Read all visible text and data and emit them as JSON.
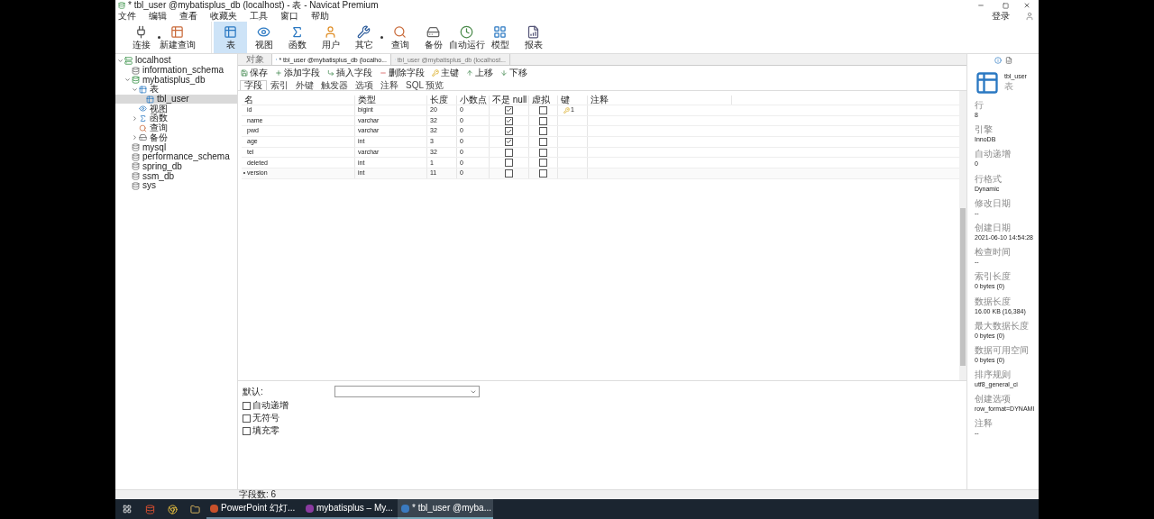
{
  "window": {
    "title": "* tbl_user @mybatisplus_db (localhost) - 表 - Navicat Premium"
  },
  "menu": [
    "文件",
    "编辑",
    "查看",
    "收藏夹",
    "工具",
    "窗口",
    "帮助"
  ],
  "login": "登录",
  "toolbar": [
    {
      "kind": "connect",
      "label": "连接",
      "selected": false,
      "dropdown": true
    },
    {
      "kind": "newquery",
      "label": "新建查询",
      "selected": false,
      "dropdown": false
    },
    {
      "kind": "table",
      "label": "表",
      "selected": true,
      "dropdown": false
    },
    {
      "kind": "view",
      "label": "视图",
      "selected": false,
      "dropdown": false
    },
    {
      "kind": "function",
      "label": "函数",
      "selected": false,
      "dropdown": false
    },
    {
      "kind": "user",
      "label": "用户",
      "selected": false,
      "dropdown": false
    },
    {
      "kind": "other",
      "label": "其它",
      "selected": false,
      "dropdown": true
    },
    {
      "kind": "query",
      "label": "查询",
      "selected": false,
      "dropdown": false
    },
    {
      "kind": "backup",
      "label": "备份",
      "selected": false,
      "dropdown": false
    },
    {
      "kind": "autorun",
      "label": "自动运行",
      "selected": false,
      "dropdown": false
    },
    {
      "kind": "model",
      "label": "模型",
      "selected": false,
      "dropdown": false
    },
    {
      "kind": "report",
      "label": "报表",
      "selected": false,
      "dropdown": false
    }
  ],
  "tree": [
    {
      "kind": "connection",
      "label": "localhost",
      "expanded": true,
      "selected": false,
      "children": [
        {
          "kind": "database",
          "label": "information_schema",
          "expanded": false,
          "selected": false
        },
        {
          "kind": "database_open",
          "label": "mybatisplus_db",
          "expanded": true,
          "selected": false,
          "children": [
            {
              "kind": "tables",
              "label": "表",
              "expanded": true,
              "selected": false,
              "children": [
                {
                  "kind": "table",
                  "label": "tbl_user",
                  "expanded": false,
                  "selected": true
                }
              ]
            },
            {
              "kind": "views",
              "label": "视图",
              "expanded": false,
              "selected": false
            },
            {
              "kind": "functions",
              "label": "函数",
              "expanded": false,
              "selected": false,
              "has_children": true
            },
            {
              "kind": "queries",
              "label": "查询",
              "expanded": false,
              "selected": false
            },
            {
              "kind": "backups",
              "label": "备份",
              "expanded": false,
              "selected": false,
              "has_children": true
            }
          ]
        },
        {
          "kind": "database",
          "label": "mysql",
          "expanded": false,
          "selected": false
        },
        {
          "kind": "database",
          "label": "performance_schema",
          "expanded": false,
          "selected": false
        },
        {
          "kind": "database",
          "label": "spring_db",
          "expanded": false,
          "selected": false
        },
        {
          "kind": "database",
          "label": "ssm_db",
          "expanded": false,
          "selected": false
        },
        {
          "kind": "database",
          "label": "sys",
          "expanded": false,
          "selected": false
        }
      ]
    }
  ],
  "tabs": [
    {
      "kind": "objects",
      "label": "对象",
      "selected": false
    },
    {
      "kind": "design",
      "label": "* tbl_user @mybatisplus_db (localho...",
      "selected": true
    },
    {
      "kind": "table",
      "label": "tbl_user @mybatisplus_db (localhost...",
      "selected": false
    }
  ],
  "editor_toolbar": [
    {
      "kind": "save",
      "label": "保存"
    },
    {
      "kind": "add",
      "label": "添加字段"
    },
    {
      "kind": "insert",
      "label": "插入字段"
    },
    {
      "kind": "delete",
      "label": "删除字段"
    },
    {
      "kind": "key",
      "label": "主键"
    },
    {
      "kind": "up",
      "label": "上移"
    },
    {
      "kind": "down",
      "label": "下移"
    }
  ],
  "subtabs": [
    {
      "label": "字段",
      "selected": true
    },
    {
      "label": "索引",
      "selected": false
    },
    {
      "label": "外键",
      "selected": false
    },
    {
      "label": "触发器",
      "selected": false
    },
    {
      "label": "选项",
      "selected": false
    },
    {
      "label": "注释",
      "selected": false
    },
    {
      "label": "SQL 预览",
      "selected": false
    }
  ],
  "table": {
    "columns": [
      "名",
      "类型",
      "长度",
      "小数点",
      "不是 null",
      "虚拟",
      "键",
      "注释"
    ],
    "rows": [
      {
        "name": "id",
        "type": "bigint",
        "length": "20",
        "decimals": "0",
        "not_null": true,
        "virtual": false,
        "key": "1",
        "current": false
      },
      {
        "name": "name",
        "type": "varchar",
        "length": "32",
        "decimals": "0",
        "not_null": true,
        "virtual": false,
        "current": false
      },
      {
        "name": "pwd",
        "type": "varchar",
        "length": "32",
        "decimals": "0",
        "not_null": true,
        "virtual": false,
        "current": false
      },
      {
        "name": "age",
        "type": "int",
        "length": "3",
        "decimals": "0",
        "not_null": true,
        "virtual": false,
        "current": false
      },
      {
        "name": "tel",
        "type": "varchar",
        "length": "32",
        "decimals": "0",
        "not_null": false,
        "virtual": false,
        "current": false
      },
      {
        "name": "deleted",
        "type": "int",
        "length": "1",
        "decimals": "0",
        "not_null": false,
        "virtual": false,
        "current": false
      },
      {
        "name": "version",
        "type": "int",
        "length": "11",
        "decimals": "0",
        "not_null": false,
        "virtual": false,
        "current": true
      }
    ]
  },
  "field_options": {
    "default_label": "默认:",
    "checkboxes": [
      {
        "label": "自动递增",
        "checked": false
      },
      {
        "label": "无符号",
        "checked": false
      },
      {
        "label": "填充零",
        "checked": false
      }
    ]
  },
  "status_bar": "字段数: 6",
  "info": {
    "name": "tbl_user",
    "type": "表",
    "properties": [
      {
        "label": "行",
        "value": "8"
      },
      {
        "label": "引擎",
        "value": "InnoDB"
      },
      {
        "label": "自动递增",
        "value": "0"
      },
      {
        "label": "行格式",
        "value": "Dynamic"
      },
      {
        "label": "修改日期",
        "value": "--"
      },
      {
        "label": "创建日期",
        "value": "2021-06-10 14:54:28"
      },
      {
        "label": "检查时间",
        "value": "--"
      },
      {
        "label": "索引长度",
        "value": "0 bytes (0)"
      },
      {
        "label": "数据长度",
        "value": "16.00 KB (16,384)"
      },
      {
        "label": "最大数据长度",
        "value": "0 bytes (0)"
      },
      {
        "label": "数据可用空间",
        "value": "0 bytes (0)"
      },
      {
        "label": "排序规则",
        "value": "utf8_general_ci"
      },
      {
        "label": "创建选项",
        "value": "row_format=DYNAMI"
      },
      {
        "label": "注释",
        "value": "--"
      }
    ]
  },
  "taskbar": [
    {
      "kind": "powerpoint",
      "label": "PowerPoint 幻灯...",
      "selected": false
    },
    {
      "kind": "idea",
      "label": "mybatisplus – My...",
      "selected": false
    },
    {
      "kind": "navicat",
      "label": "* tbl_user @myba...",
      "selected": true
    }
  ]
}
